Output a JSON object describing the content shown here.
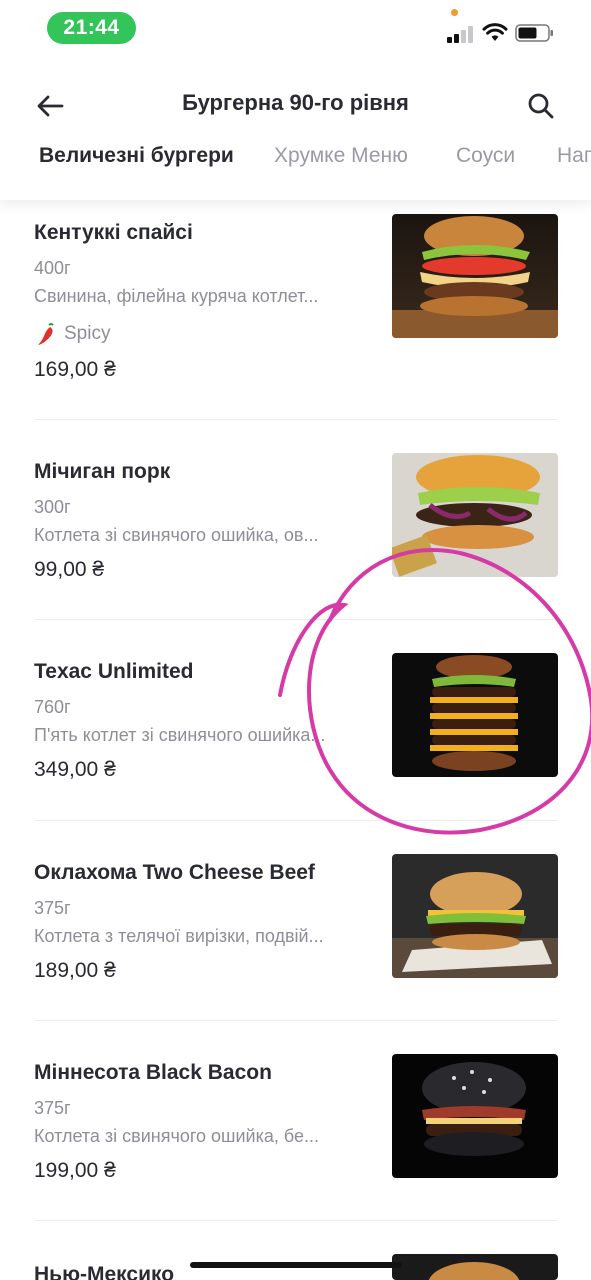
{
  "status_bar": {
    "time": "21:44",
    "icons": [
      "signal-icon",
      "wifi-icon",
      "battery-icon"
    ],
    "time_color": "#33c45a"
  },
  "header": {
    "title": "Бургерна 90-го рівня",
    "back_icon": "arrow-left-icon",
    "search_icon": "search-icon"
  },
  "tabs": [
    {
      "label": "Величезні бургери",
      "active": true
    },
    {
      "label": "Хрумке Меню",
      "active": false
    },
    {
      "label": "Соуси",
      "active": false
    },
    {
      "label": "Напої",
      "active": false
    }
  ],
  "items": [
    {
      "name": "Кентуккі спайсі",
      "weight": "400г",
      "description": "Свинина, філейна куряча котлет...",
      "badge": "Spicy",
      "badge_icon": "chili-pepper-icon",
      "price": "169,00 ₴"
    },
    {
      "name": "Мічиган порк",
      "weight": "300г",
      "description": "Котлета зі свинячого ошийка, ов...",
      "price": "99,00 ₴"
    },
    {
      "name": "Texac Unlimited",
      "weight": "760г",
      "description": "П'ять котлет зі свинячого ошийка...",
      "price": "349,00 ₴"
    },
    {
      "name": "Оклахома Two Cheese Beef",
      "weight": "375г",
      "description": "Котлета з телячої вирізки, подвій...",
      "price": "189,00 ₴"
    },
    {
      "name": "Міннесота Black Bacon",
      "weight": "375г",
      "description": "Котлета зі свинячого ошийка, бе...",
      "price": "199,00 ₴"
    },
    {
      "name": "Нью-Мексико"
    }
  ],
  "colors": {
    "annotation": "#d63aa6",
    "text_primary": "#2a2a33",
    "text_secondary": "#8e8e99"
  }
}
